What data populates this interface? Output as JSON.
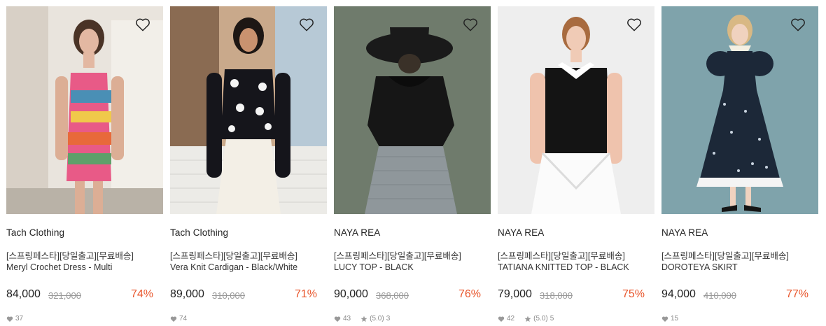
{
  "products": [
    {
      "brand": "Tach Clothing",
      "tags": "[스프링페스타][당일출고][무료배송]",
      "name": "Meryl Crochet Dress - Multi",
      "price": "84,000",
      "original_price": "321,000",
      "discount": "74%",
      "likes": "37",
      "rating": null,
      "reviews": null
    },
    {
      "brand": "Tach Clothing",
      "tags": "[스프링페스타][당일출고][무료배송]",
      "name": "Vera Knit Cardigan - Black/White",
      "price": "89,000",
      "original_price": "310,000",
      "discount": "71%",
      "likes": "74",
      "rating": null,
      "reviews": null
    },
    {
      "brand": "NAYA REA",
      "tags": "[스프링페스타][당일출고][무료배송]",
      "name": "LUCY TOP - BLACK",
      "price": "90,000",
      "original_price": "368,000",
      "discount": "76%",
      "likes": "43",
      "rating": "(5.0)",
      "reviews": "3"
    },
    {
      "brand": "NAYA REA",
      "tags": "[스프링페스타][당일출고][무료배송]",
      "name": "TATIANA KNITTED TOP - BLACK",
      "price": "79,000",
      "original_price": "318,000",
      "discount": "75%",
      "likes": "42",
      "rating": "(5.0)",
      "reviews": "5"
    },
    {
      "brand": "NAYA REA",
      "tags": "[스프링페스타][당일출고][무료배송]",
      "name": "DOROTEYA SKIRT",
      "price": "94,000",
      "original_price": "410,000",
      "discount": "77%",
      "likes": "15",
      "rating": null,
      "reviews": null
    }
  ],
  "icons": {
    "wishlist": "heart-outline-icon",
    "likes": "heart-filled-icon",
    "rating": "star-icon"
  },
  "colors": {
    "discount": "#e8552b",
    "strikethrough": "#999999",
    "meta": "#888888"
  }
}
